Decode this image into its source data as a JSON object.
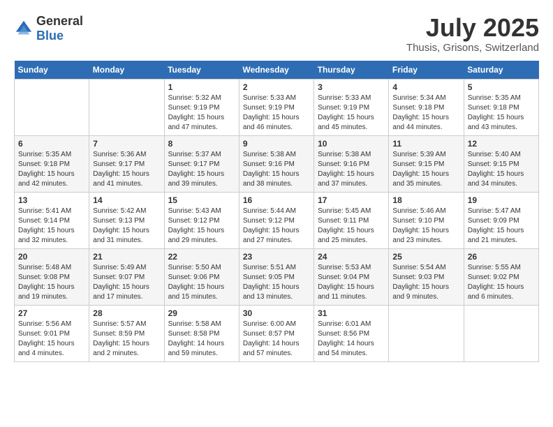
{
  "logo": {
    "general": "General",
    "blue": "Blue"
  },
  "title": "July 2025",
  "location": "Thusis, Grisons, Switzerland",
  "weekdays": [
    "Sunday",
    "Monday",
    "Tuesday",
    "Wednesday",
    "Thursday",
    "Friday",
    "Saturday"
  ],
  "weeks": [
    [
      {
        "day": "",
        "sunrise": "",
        "sunset": "",
        "daylight": ""
      },
      {
        "day": "",
        "sunrise": "",
        "sunset": "",
        "daylight": ""
      },
      {
        "day": "1",
        "sunrise": "Sunrise: 5:32 AM",
        "sunset": "Sunset: 9:19 PM",
        "daylight": "Daylight: 15 hours and 47 minutes."
      },
      {
        "day": "2",
        "sunrise": "Sunrise: 5:33 AM",
        "sunset": "Sunset: 9:19 PM",
        "daylight": "Daylight: 15 hours and 46 minutes."
      },
      {
        "day": "3",
        "sunrise": "Sunrise: 5:33 AM",
        "sunset": "Sunset: 9:19 PM",
        "daylight": "Daylight: 15 hours and 45 minutes."
      },
      {
        "day": "4",
        "sunrise": "Sunrise: 5:34 AM",
        "sunset": "Sunset: 9:18 PM",
        "daylight": "Daylight: 15 hours and 44 minutes."
      },
      {
        "day": "5",
        "sunrise": "Sunrise: 5:35 AM",
        "sunset": "Sunset: 9:18 PM",
        "daylight": "Daylight: 15 hours and 43 minutes."
      }
    ],
    [
      {
        "day": "6",
        "sunrise": "Sunrise: 5:35 AM",
        "sunset": "Sunset: 9:18 PM",
        "daylight": "Daylight: 15 hours and 42 minutes."
      },
      {
        "day": "7",
        "sunrise": "Sunrise: 5:36 AM",
        "sunset": "Sunset: 9:17 PM",
        "daylight": "Daylight: 15 hours and 41 minutes."
      },
      {
        "day": "8",
        "sunrise": "Sunrise: 5:37 AM",
        "sunset": "Sunset: 9:17 PM",
        "daylight": "Daylight: 15 hours and 39 minutes."
      },
      {
        "day": "9",
        "sunrise": "Sunrise: 5:38 AM",
        "sunset": "Sunset: 9:16 PM",
        "daylight": "Daylight: 15 hours and 38 minutes."
      },
      {
        "day": "10",
        "sunrise": "Sunrise: 5:38 AM",
        "sunset": "Sunset: 9:16 PM",
        "daylight": "Daylight: 15 hours and 37 minutes."
      },
      {
        "day": "11",
        "sunrise": "Sunrise: 5:39 AM",
        "sunset": "Sunset: 9:15 PM",
        "daylight": "Daylight: 15 hours and 35 minutes."
      },
      {
        "day": "12",
        "sunrise": "Sunrise: 5:40 AM",
        "sunset": "Sunset: 9:15 PM",
        "daylight": "Daylight: 15 hours and 34 minutes."
      }
    ],
    [
      {
        "day": "13",
        "sunrise": "Sunrise: 5:41 AM",
        "sunset": "Sunset: 9:14 PM",
        "daylight": "Daylight: 15 hours and 32 minutes."
      },
      {
        "day": "14",
        "sunrise": "Sunrise: 5:42 AM",
        "sunset": "Sunset: 9:13 PM",
        "daylight": "Daylight: 15 hours and 31 minutes."
      },
      {
        "day": "15",
        "sunrise": "Sunrise: 5:43 AM",
        "sunset": "Sunset: 9:12 PM",
        "daylight": "Daylight: 15 hours and 29 minutes."
      },
      {
        "day": "16",
        "sunrise": "Sunrise: 5:44 AM",
        "sunset": "Sunset: 9:12 PM",
        "daylight": "Daylight: 15 hours and 27 minutes."
      },
      {
        "day": "17",
        "sunrise": "Sunrise: 5:45 AM",
        "sunset": "Sunset: 9:11 PM",
        "daylight": "Daylight: 15 hours and 25 minutes."
      },
      {
        "day": "18",
        "sunrise": "Sunrise: 5:46 AM",
        "sunset": "Sunset: 9:10 PM",
        "daylight": "Daylight: 15 hours and 23 minutes."
      },
      {
        "day": "19",
        "sunrise": "Sunrise: 5:47 AM",
        "sunset": "Sunset: 9:09 PM",
        "daylight": "Daylight: 15 hours and 21 minutes."
      }
    ],
    [
      {
        "day": "20",
        "sunrise": "Sunrise: 5:48 AM",
        "sunset": "Sunset: 9:08 PM",
        "daylight": "Daylight: 15 hours and 19 minutes."
      },
      {
        "day": "21",
        "sunrise": "Sunrise: 5:49 AM",
        "sunset": "Sunset: 9:07 PM",
        "daylight": "Daylight: 15 hours and 17 minutes."
      },
      {
        "day": "22",
        "sunrise": "Sunrise: 5:50 AM",
        "sunset": "Sunset: 9:06 PM",
        "daylight": "Daylight: 15 hours and 15 minutes."
      },
      {
        "day": "23",
        "sunrise": "Sunrise: 5:51 AM",
        "sunset": "Sunset: 9:05 PM",
        "daylight": "Daylight: 15 hours and 13 minutes."
      },
      {
        "day": "24",
        "sunrise": "Sunrise: 5:53 AM",
        "sunset": "Sunset: 9:04 PM",
        "daylight": "Daylight: 15 hours and 11 minutes."
      },
      {
        "day": "25",
        "sunrise": "Sunrise: 5:54 AM",
        "sunset": "Sunset: 9:03 PM",
        "daylight": "Daylight: 15 hours and 9 minutes."
      },
      {
        "day": "26",
        "sunrise": "Sunrise: 5:55 AM",
        "sunset": "Sunset: 9:02 PM",
        "daylight": "Daylight: 15 hours and 6 minutes."
      }
    ],
    [
      {
        "day": "27",
        "sunrise": "Sunrise: 5:56 AM",
        "sunset": "Sunset: 9:01 PM",
        "daylight": "Daylight: 15 hours and 4 minutes."
      },
      {
        "day": "28",
        "sunrise": "Sunrise: 5:57 AM",
        "sunset": "Sunset: 8:59 PM",
        "daylight": "Daylight: 15 hours and 2 minutes."
      },
      {
        "day": "29",
        "sunrise": "Sunrise: 5:58 AM",
        "sunset": "Sunset: 8:58 PM",
        "daylight": "Daylight: 14 hours and 59 minutes."
      },
      {
        "day": "30",
        "sunrise": "Sunrise: 6:00 AM",
        "sunset": "Sunset: 8:57 PM",
        "daylight": "Daylight: 14 hours and 57 minutes."
      },
      {
        "day": "31",
        "sunrise": "Sunrise: 6:01 AM",
        "sunset": "Sunset: 8:56 PM",
        "daylight": "Daylight: 14 hours and 54 minutes."
      },
      {
        "day": "",
        "sunrise": "",
        "sunset": "",
        "daylight": ""
      },
      {
        "day": "",
        "sunrise": "",
        "sunset": "",
        "daylight": ""
      }
    ]
  ]
}
